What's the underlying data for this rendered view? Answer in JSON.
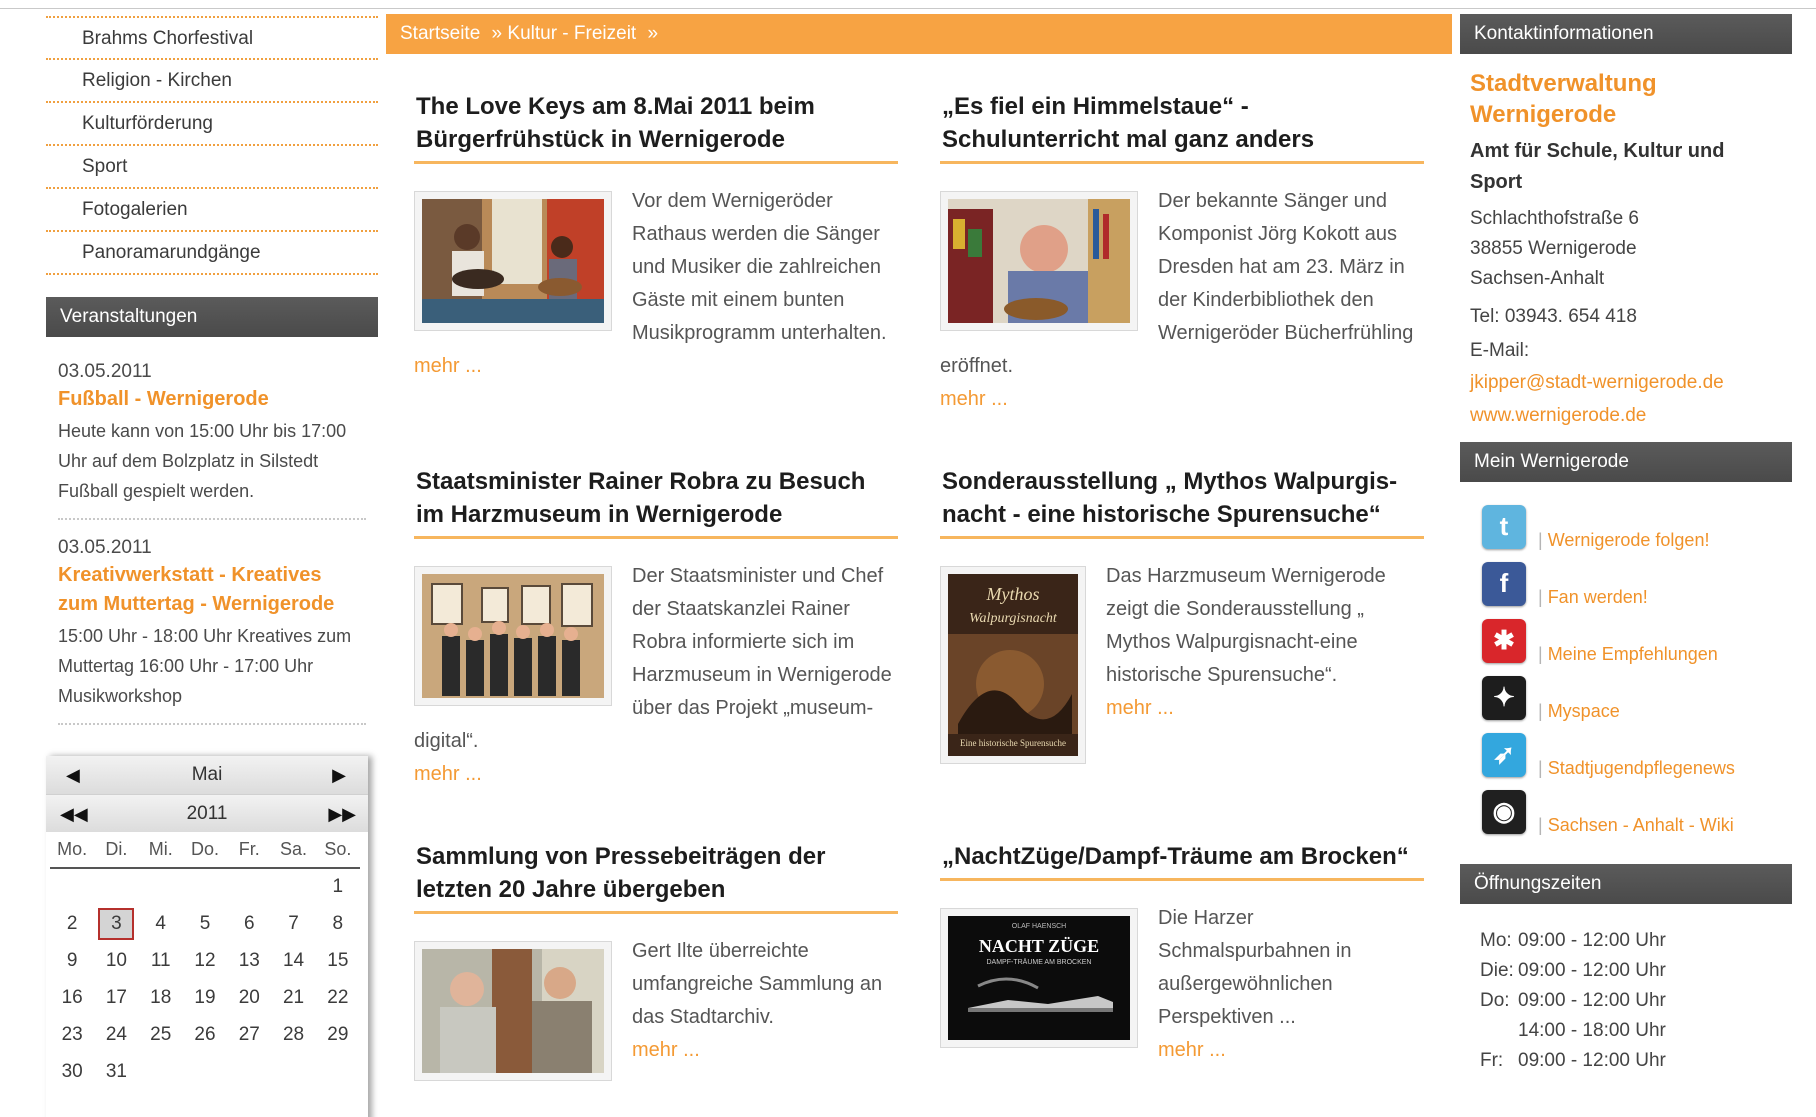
{
  "left_nav": {
    "items": [
      "Brahms Chorfestival",
      "Religion - Kirchen",
      "Kulturförderung",
      "Sport",
      "Fotogalerien",
      "Panoramarundgänge"
    ]
  },
  "events": {
    "header": "Veranstaltungen",
    "items": [
      {
        "date": "03.05.2011",
        "title": "Fußball - Wernigerode",
        "desc": "Heute kann von 15:00 Uhr bis 17:00 Uhr auf dem Bolzplatz in Silstedt Fußball gespielt werden."
      },
      {
        "date": "03.05.2011",
        "title": "Kreativwerkstatt - Kreatives zum Muttertag - Wernigerode",
        "desc": "15:00 Uhr - 18:00 Uhr Kreatives zum Muttertag 16:00 Uhr - 17:00 Uhr Musikworkshop"
      }
    ]
  },
  "calendar": {
    "month": "Mai",
    "year": "2011",
    "weekdays": [
      "Mo.",
      "Di.",
      "Mi.",
      "Do.",
      "Fr.",
      "Sa.",
      "So."
    ],
    "selected_day": "3",
    "weeks": [
      [
        "",
        "",
        "",
        "",
        "",
        "",
        "1"
      ],
      [
        "2",
        "3",
        "4",
        "5",
        "6",
        "7",
        "8"
      ],
      [
        "9",
        "10",
        "11",
        "12",
        "13",
        "14",
        "15"
      ],
      [
        "16",
        "17",
        "18",
        "19",
        "20",
        "21",
        "22"
      ],
      [
        "23",
        "24",
        "25",
        "26",
        "27",
        "28",
        "29"
      ],
      [
        "30",
        "31",
        "",
        "",
        "",
        "",
        ""
      ]
    ]
  },
  "breadcrumb": {
    "items": [
      "Startseite",
      "» Kultur - Freizeit",
      "»"
    ]
  },
  "articles": [
    {
      "title": "The Love Keys am 8.Mai 2011 beim Bürgerfrühstück in Wernigerode",
      "text": "Vor dem Wernigeröder Rathaus werden die Sänger und Musiker die zahlreichen Gäste mit einem bunten Musikprogramm unterhalten.",
      "more": "mehr ..."
    },
    {
      "title": "„Es fiel ein Himmelstaue“ - Schulunterricht mal ganz anders",
      "text": "Der bekannte Sänger und Komponist Jörg Kokott aus Dresden hat am 23. März in der Kinderbibliothek den Wernigeröder Bücherfrühling eröffnet.",
      "more": "mehr ..."
    },
    {
      "title": "Staatsminister Rainer Robra zu Besuch im Harzmuseum in Wernigerode",
      "text": "Der Staatsminister und Chef der Staatskanzlei Rainer Robra informierte sich im Harzmuseum in Wernigerode über das Projekt „museum-digital“.",
      "more": "mehr ..."
    },
    {
      "title": "Sonderausstellung „ Mythos Walpurgis-nacht - eine historische Spurensuche“",
      "text": "Das Harzmuseum Wernigerode zeigt die Sonderausstellung „ Mythos Walpurgisnacht-eine historische Spurensuche“.",
      "more": "mehr ...",
      "poster_title": "Mythos Walpurgisnacht",
      "poster_sub": "Eine historische Spurensuche"
    },
    {
      "title": "Sammlung von Pressebeiträgen der letzten 20 Jahre übergeben",
      "text": "Gert Ilte überreichte umfangreiche Sammlung an das Stadtarchiv.",
      "more": "mehr ..."
    },
    {
      "title": "„NachtZüge/Dampf-Träume am Brocken“",
      "text": "Die Harzer Schmalspurbahnen in außergewöhnlichen Perspektiven ...",
      "more": "mehr ...",
      "cover_title": "NACHT ZÜGE",
      "cover_sub": "DAMPF-TRÄUME AM BROCKEN",
      "cover_author": "OLAF HAENSCH"
    }
  ],
  "contact": {
    "header": "Kontaktinformationen",
    "org": "Stadtverwaltung Wernigerode",
    "dept": "Amt für Schule, Kultur und Sport",
    "street": "Schlachthofstraße 6",
    "city": "38855 Wernigerode",
    "state": "Sachsen-Anhalt",
    "phone": "Tel: 03943. 654 418",
    "email_label": "E-Mail:",
    "email": "jkipper@stadt-wernigerode.de",
    "web": "www.wernigerode.de"
  },
  "social": {
    "header": "Mein Wernigerode",
    "items": [
      {
        "label": "Wernigerode folgen!",
        "icon": "twitter-icon",
        "glyph": "t",
        "color": "#5fb5df"
      },
      {
        "label": "Fan werden!",
        "icon": "facebook-icon",
        "glyph": "f",
        "color": "#3b5998"
      },
      {
        "label": "Meine Empfehlungen",
        "icon": "recommend-icon",
        "glyph": "✱",
        "color": "#d9262b"
      },
      {
        "label": "Myspace",
        "icon": "myspace-icon",
        "glyph": "✦",
        "color": "#1d1d1d"
      },
      {
        "label": "Stadtjugendpflegenews",
        "icon": "bird-icon",
        "glyph": "➶",
        "color": "#33a7de"
      },
      {
        "label": "Sachsen - Anhalt - Wiki",
        "icon": "wiki-icon",
        "glyph": "◉",
        "color": "#202020"
      }
    ]
  },
  "hours": {
    "header": "Öffnungszeiten",
    "rows": [
      {
        "day": "Mo:",
        "time": "09:00 - 12:00 Uhr"
      },
      {
        "day": "Die:",
        "time": "09:00 - 12:00 Uhr"
      },
      {
        "day": "Do:",
        "time": "09:00 - 12:00 Uhr"
      },
      {
        "day": "",
        "time": "14:00 - 18:00 Uhr"
      },
      {
        "day": "Fr:",
        "time": "09:00 - 12:00 Uhr"
      }
    ]
  }
}
